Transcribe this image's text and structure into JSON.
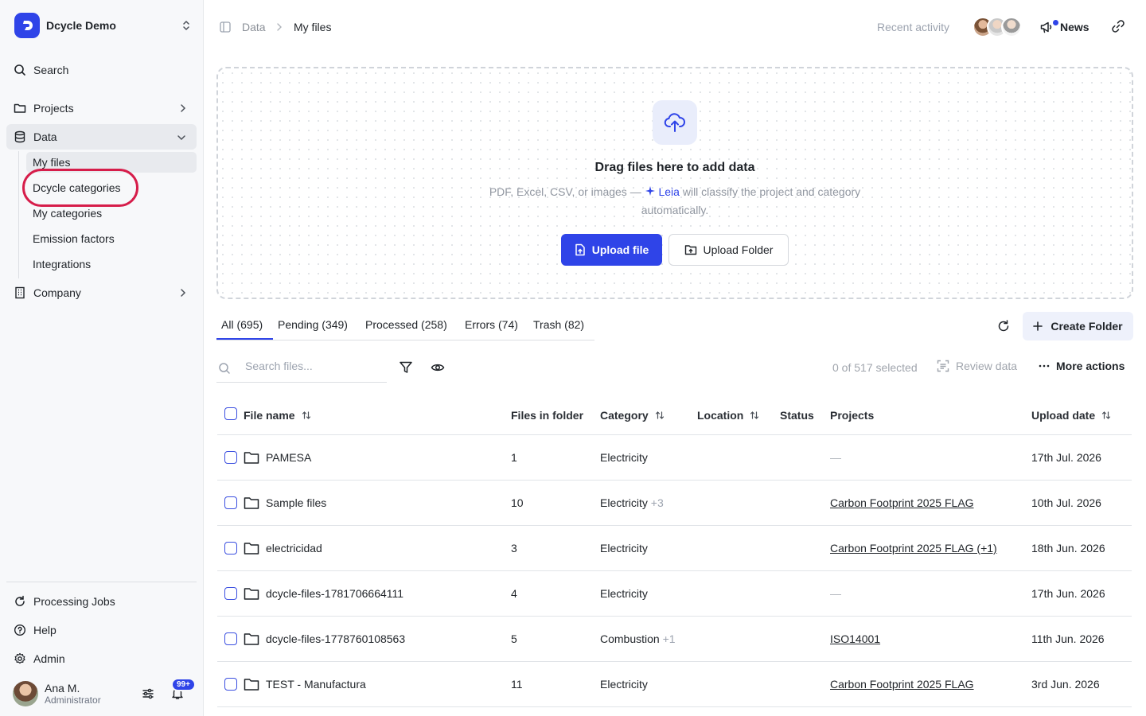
{
  "org": {
    "name": "Dcycle Demo"
  },
  "nav": {
    "search": "Search",
    "projects": "Projects",
    "data": "Data",
    "company": "Company",
    "sub": [
      "My files",
      "Dcycle categories",
      "My categories",
      "Emission factors",
      "Integrations"
    ],
    "bottom": [
      "Processing Jobs",
      "Help",
      "Admin"
    ]
  },
  "user": {
    "name": "Ana M.",
    "role": "Administrator",
    "badge": "99+"
  },
  "breadcrumb": {
    "parent": "Data",
    "current": "My files"
  },
  "header": {
    "recent_activity": "Recent activity",
    "news": "News"
  },
  "dropzone": {
    "title": "Drag files here to add data",
    "sub_prefix": "PDF, Excel, CSV, or images —",
    "leia": "Leia",
    "sub_suffix": "will classify the project and category automatically.",
    "upload_file": "Upload file",
    "upload_folder": "Upload Folder"
  },
  "tabs": [
    {
      "label": "All",
      "count": "(695)"
    },
    {
      "label": "Pending",
      "count": "(349)"
    },
    {
      "label": "Processed",
      "count": "(258)"
    },
    {
      "label": "Errors",
      "count": "(74)"
    },
    {
      "label": "Trash",
      "count": "(82)"
    }
  ],
  "actions": {
    "create_folder": "Create Folder",
    "search_placeholder": "Search files...",
    "selected": "0 of 517 selected",
    "review": "Review data",
    "more": "More actions"
  },
  "table": {
    "columns": [
      "File name",
      "Files in folder",
      "Category",
      "Location",
      "Status",
      "Projects",
      "Upload date"
    ],
    "rows": [
      {
        "name": "PAMESA",
        "files": "1",
        "category": "Electricity",
        "extra": "",
        "project": "—",
        "project_link": false,
        "date": "17th Jul. 2026"
      },
      {
        "name": "Sample files",
        "files": "10",
        "category": "Electricity",
        "extra": "+3",
        "project": "Carbon Footprint 2025 FLAG",
        "project_link": true,
        "date": "10th Jul. 2026"
      },
      {
        "name": "electricidad",
        "files": "3",
        "category": "Electricity",
        "extra": "",
        "project": "Carbon Footprint 2025 FLAG (+1)",
        "project_link": true,
        "date": "18th Jun. 2026"
      },
      {
        "name": "dcycle-files-1781706664111",
        "files": "4",
        "category": "Electricity",
        "extra": "",
        "project": "—",
        "project_link": false,
        "date": "17th Jun. 2026"
      },
      {
        "name": "dcycle-files-1778760108563",
        "files": "5",
        "category": "Combustion",
        "extra": "+1",
        "project": "ISO14001",
        "project_link": true,
        "date": "11th Jun. 2026"
      },
      {
        "name": "TEST - Manufactura",
        "files": "11",
        "category": "Electricity",
        "extra": "",
        "project": "Carbon Footprint 2025 FLAG",
        "project_link": true,
        "date": "3rd Jun. 2026"
      }
    ]
  },
  "colors": {
    "brand": "#2f44e8",
    "highlight": "#d61d4a"
  }
}
